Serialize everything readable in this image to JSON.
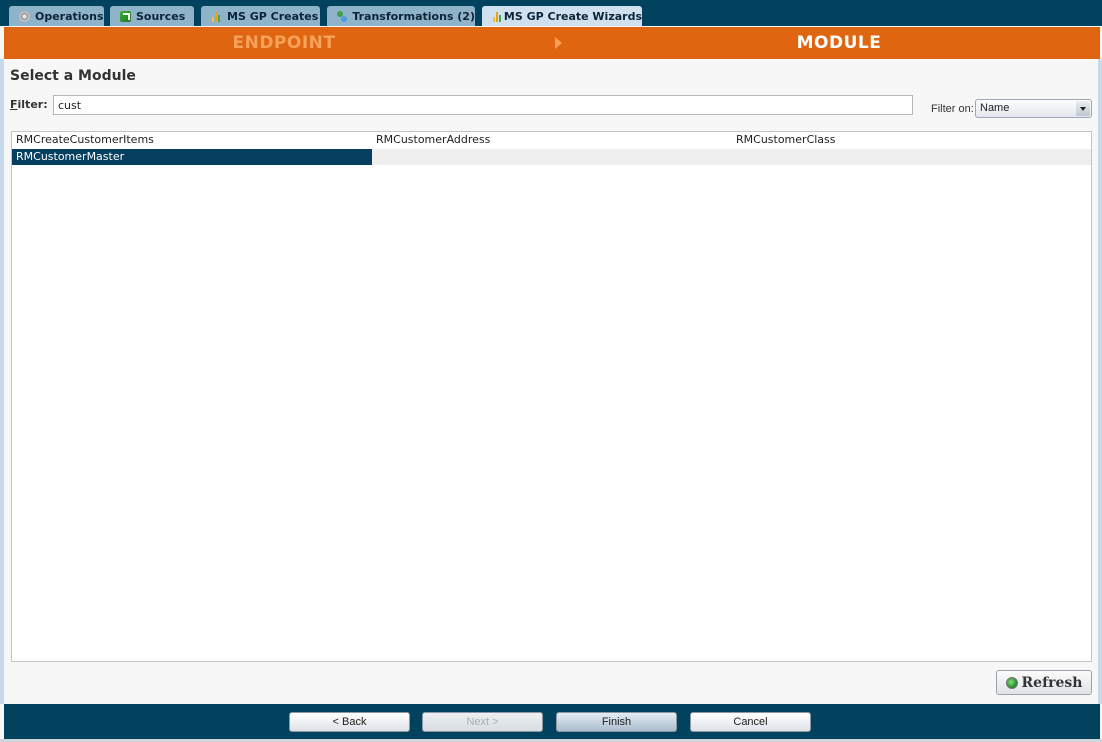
{
  "tabs": [
    {
      "label": "Operations",
      "icon": "operations-icon",
      "active": false
    },
    {
      "label": "Sources",
      "icon": "sources-icon",
      "active": false
    },
    {
      "label": "MS GP Creates",
      "icon": "chart-icon",
      "active": false
    },
    {
      "label": "Transformations (2)",
      "icon": "transformations-icon",
      "active": false
    },
    {
      "label": "MS GP Create Wizards",
      "icon": "chart-icon",
      "active": true
    }
  ],
  "wizard": {
    "steps": [
      {
        "label": "ENDPOINT",
        "state": "completed"
      },
      {
        "label": "MODULE",
        "state": "current"
      }
    ]
  },
  "page": {
    "title": "Select a Module",
    "filter_label_accel": "F",
    "filter_label_rest": "ilter:",
    "filter_value": "cust",
    "filter_on_label": "Filter on:",
    "filter_on_selected": "Name"
  },
  "modules": {
    "rows": [
      [
        "RMCreateCustomerItems",
        "RMCustomerAddress",
        "RMCustomerClass"
      ],
      [
        "RMCustomerMaster",
        "",
        ""
      ]
    ],
    "selected": "RMCustomerMaster"
  },
  "buttons": {
    "refresh": "Refresh",
    "back": "< Back",
    "next": "Next >",
    "finish": "Finish",
    "cancel": "Cancel"
  },
  "colors": {
    "navy": "#01435f",
    "orange": "#e06510",
    "selection": "#063f5f"
  }
}
